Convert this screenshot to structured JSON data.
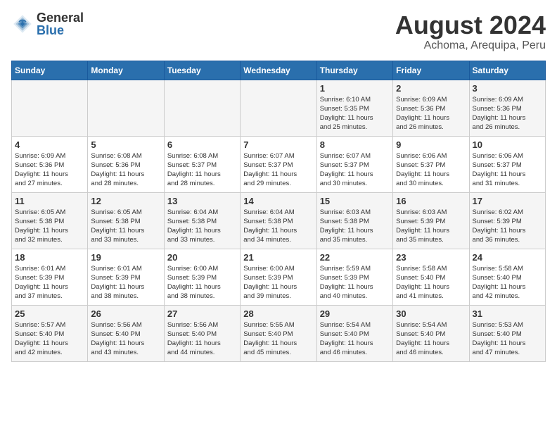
{
  "header": {
    "logo_general": "General",
    "logo_blue": "Blue",
    "title": "August 2024",
    "subtitle": "Achoma, Arequipa, Peru"
  },
  "weekdays": [
    "Sunday",
    "Monday",
    "Tuesday",
    "Wednesday",
    "Thursday",
    "Friday",
    "Saturday"
  ],
  "weeks": [
    [
      {
        "day": "",
        "info": ""
      },
      {
        "day": "",
        "info": ""
      },
      {
        "day": "",
        "info": ""
      },
      {
        "day": "",
        "info": ""
      },
      {
        "day": "1",
        "info": "Sunrise: 6:10 AM\nSunset: 5:35 PM\nDaylight: 11 hours\nand 25 minutes."
      },
      {
        "day": "2",
        "info": "Sunrise: 6:09 AM\nSunset: 5:36 PM\nDaylight: 11 hours\nand 26 minutes."
      },
      {
        "day": "3",
        "info": "Sunrise: 6:09 AM\nSunset: 5:36 PM\nDaylight: 11 hours\nand 26 minutes."
      }
    ],
    [
      {
        "day": "4",
        "info": "Sunrise: 6:09 AM\nSunset: 5:36 PM\nDaylight: 11 hours\nand 27 minutes."
      },
      {
        "day": "5",
        "info": "Sunrise: 6:08 AM\nSunset: 5:36 PM\nDaylight: 11 hours\nand 28 minutes."
      },
      {
        "day": "6",
        "info": "Sunrise: 6:08 AM\nSunset: 5:37 PM\nDaylight: 11 hours\nand 28 minutes."
      },
      {
        "day": "7",
        "info": "Sunrise: 6:07 AM\nSunset: 5:37 PM\nDaylight: 11 hours\nand 29 minutes."
      },
      {
        "day": "8",
        "info": "Sunrise: 6:07 AM\nSunset: 5:37 PM\nDaylight: 11 hours\nand 30 minutes."
      },
      {
        "day": "9",
        "info": "Sunrise: 6:06 AM\nSunset: 5:37 PM\nDaylight: 11 hours\nand 30 minutes."
      },
      {
        "day": "10",
        "info": "Sunrise: 6:06 AM\nSunset: 5:37 PM\nDaylight: 11 hours\nand 31 minutes."
      }
    ],
    [
      {
        "day": "11",
        "info": "Sunrise: 6:05 AM\nSunset: 5:38 PM\nDaylight: 11 hours\nand 32 minutes."
      },
      {
        "day": "12",
        "info": "Sunrise: 6:05 AM\nSunset: 5:38 PM\nDaylight: 11 hours\nand 33 minutes."
      },
      {
        "day": "13",
        "info": "Sunrise: 6:04 AM\nSunset: 5:38 PM\nDaylight: 11 hours\nand 33 minutes."
      },
      {
        "day": "14",
        "info": "Sunrise: 6:04 AM\nSunset: 5:38 PM\nDaylight: 11 hours\nand 34 minutes."
      },
      {
        "day": "15",
        "info": "Sunrise: 6:03 AM\nSunset: 5:38 PM\nDaylight: 11 hours\nand 35 minutes."
      },
      {
        "day": "16",
        "info": "Sunrise: 6:03 AM\nSunset: 5:39 PM\nDaylight: 11 hours\nand 35 minutes."
      },
      {
        "day": "17",
        "info": "Sunrise: 6:02 AM\nSunset: 5:39 PM\nDaylight: 11 hours\nand 36 minutes."
      }
    ],
    [
      {
        "day": "18",
        "info": "Sunrise: 6:01 AM\nSunset: 5:39 PM\nDaylight: 11 hours\nand 37 minutes."
      },
      {
        "day": "19",
        "info": "Sunrise: 6:01 AM\nSunset: 5:39 PM\nDaylight: 11 hours\nand 38 minutes."
      },
      {
        "day": "20",
        "info": "Sunrise: 6:00 AM\nSunset: 5:39 PM\nDaylight: 11 hours\nand 38 minutes."
      },
      {
        "day": "21",
        "info": "Sunrise: 6:00 AM\nSunset: 5:39 PM\nDaylight: 11 hours\nand 39 minutes."
      },
      {
        "day": "22",
        "info": "Sunrise: 5:59 AM\nSunset: 5:39 PM\nDaylight: 11 hours\nand 40 minutes."
      },
      {
        "day": "23",
        "info": "Sunrise: 5:58 AM\nSunset: 5:40 PM\nDaylight: 11 hours\nand 41 minutes."
      },
      {
        "day": "24",
        "info": "Sunrise: 5:58 AM\nSunset: 5:40 PM\nDaylight: 11 hours\nand 42 minutes."
      }
    ],
    [
      {
        "day": "25",
        "info": "Sunrise: 5:57 AM\nSunset: 5:40 PM\nDaylight: 11 hours\nand 42 minutes."
      },
      {
        "day": "26",
        "info": "Sunrise: 5:56 AM\nSunset: 5:40 PM\nDaylight: 11 hours\nand 43 minutes."
      },
      {
        "day": "27",
        "info": "Sunrise: 5:56 AM\nSunset: 5:40 PM\nDaylight: 11 hours\nand 44 minutes."
      },
      {
        "day": "28",
        "info": "Sunrise: 5:55 AM\nSunset: 5:40 PM\nDaylight: 11 hours\nand 45 minutes."
      },
      {
        "day": "29",
        "info": "Sunrise: 5:54 AM\nSunset: 5:40 PM\nDaylight: 11 hours\nand 46 minutes."
      },
      {
        "day": "30",
        "info": "Sunrise: 5:54 AM\nSunset: 5:40 PM\nDaylight: 11 hours\nand 46 minutes."
      },
      {
        "day": "31",
        "info": "Sunrise: 5:53 AM\nSunset: 5:40 PM\nDaylight: 11 hours\nand 47 minutes."
      }
    ]
  ]
}
